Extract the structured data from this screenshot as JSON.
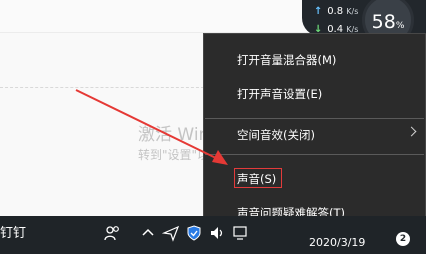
{
  "watermark": {
    "line1": "激活 Windo",
    "line2": "转到\"设置\"以激活 Windows。"
  },
  "network": {
    "up_value": "0.8",
    "up_unit": "K/s",
    "down_value": "0.4",
    "down_unit": "K/s",
    "up_arrow": "↑",
    "down_arrow": "↓"
  },
  "cpu": {
    "value": "58",
    "unit": "%"
  },
  "menu": {
    "items": [
      {
        "label": "打开音量混合器(M)"
      },
      {
        "label": "打开声音设置(E)"
      },
      {
        "label": "空间音效(关闭)"
      },
      {
        "label": "声音(S)"
      },
      {
        "label": "声音问题疑难解答(T)"
      }
    ]
  },
  "taskbar": {
    "app_label": "钉钉",
    "date": "2020/3/19",
    "notification_count": "2"
  },
  "colors": {
    "menu_bg": "#2b2b2b",
    "taskbar_bg": "#1f2428",
    "highlight": "#e23b3b",
    "arrow": "#e53935"
  },
  "icons": [
    "people-icon",
    "chevron-up-icon",
    "send-icon",
    "shield-icon",
    "speaker-icon",
    "network-icon",
    "notification-icon"
  ]
}
